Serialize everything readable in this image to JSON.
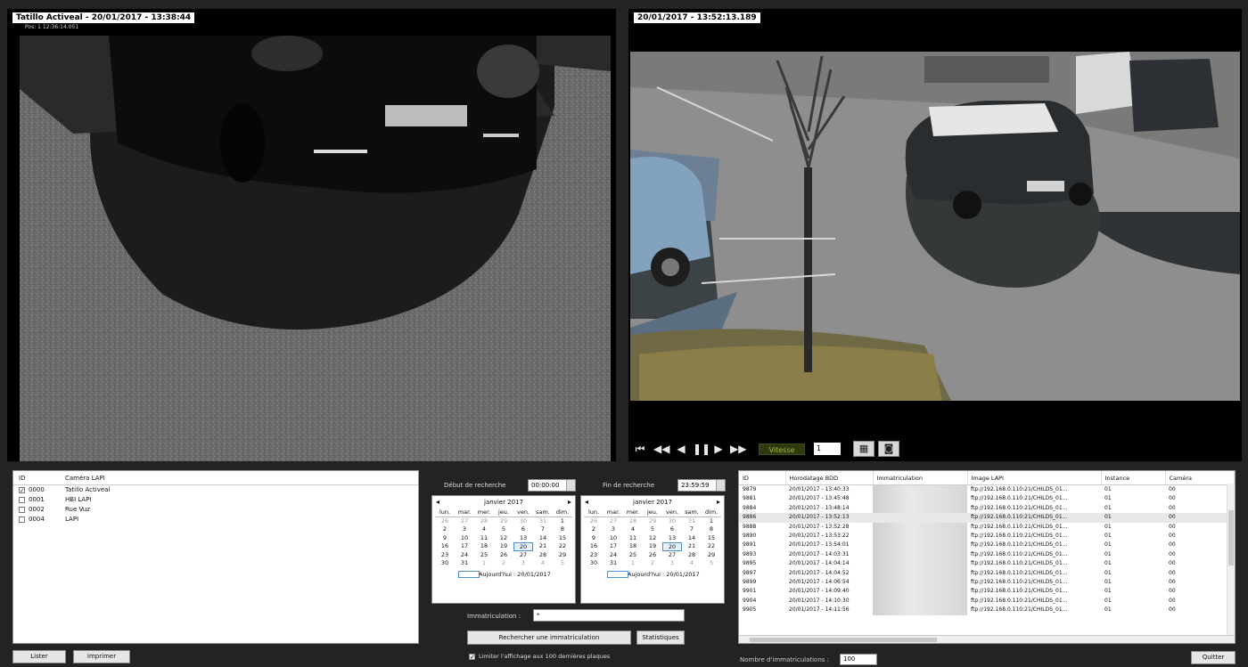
{
  "left_camera": {
    "title": "Tatillo Activeal - 20/01/2017 - 13:38:44",
    "sub": "Pos:          1     12:36:14.051"
  },
  "right_camera": {
    "title": "20/01/2017 - 13:52:13.189"
  },
  "playback": {
    "speed_label": "Vitesse",
    "speed_value": "1"
  },
  "camera_list": {
    "headers": [
      "ID",
      "Caméra LAPI"
    ],
    "rows": [
      {
        "id": "0000",
        "name": "Tatillo Activeal",
        "checked": true
      },
      {
        "id": "0001",
        "name": "HBI LAPI",
        "checked": false
      },
      {
        "id": "0002",
        "name": "Rue Vuz",
        "checked": false
      },
      {
        "id": "0004",
        "name": "LAPI",
        "checked": false
      }
    ],
    "btn_list": "Lister",
    "btn_print": "Imprimer"
  },
  "search": {
    "start_label": "Début de recherche",
    "start_time": "00:00:00",
    "end_label": "Fin de recherche",
    "end_time": "23:59:59",
    "plate_label": "Immatriculation :",
    "plate_value": "*",
    "search_btn": "Rechercher une immatriculation",
    "stats_btn": "Statistiques",
    "limit_label": "Limiter l'affichage aux 100 dernières plaques"
  },
  "calendar": {
    "month": "janvier 2017",
    "days_of_week": [
      "lun.",
      "mar.",
      "mer.",
      "jeu.",
      "ven.",
      "sam.",
      "dim."
    ],
    "weeks": [
      [
        "26",
        "27",
        "28",
        "29",
        "30",
        "31",
        "1"
      ],
      [
        "2",
        "3",
        "4",
        "5",
        "6",
        "7",
        "8"
      ],
      [
        "9",
        "10",
        "11",
        "12",
        "13",
        "14",
        "15"
      ],
      [
        "16",
        "17",
        "18",
        "19",
        "20",
        "21",
        "22"
      ],
      [
        "23",
        "24",
        "25",
        "26",
        "27",
        "28",
        "29"
      ],
      [
        "30",
        "31",
        "1",
        "2",
        "3",
        "4",
        "5"
      ]
    ],
    "selected": "20",
    "today": "Aujourd'hui : 20/01/2017"
  },
  "results": {
    "headers": [
      "ID",
      "Horodatage BDD",
      "Immatriculation",
      "Image LAPI",
      "Instance",
      "Caméra"
    ],
    "rows": [
      [
        "9879",
        "20/01/2017 - 13:40:33",
        "",
        "ftp://192.168.0.110:21/CHILDS_01...",
        "01",
        "00"
      ],
      [
        "9881",
        "20/01/2017 - 13:45:48",
        "",
        "ftp://192.168.0.110:21/CHILDS_01...",
        "01",
        "00"
      ],
      [
        "9884",
        "20/01/2017 - 13:48:14",
        "",
        "ftp://192.168.0.110:21/CHILDS_01...",
        "01",
        "00"
      ],
      [
        "9886",
        "20/01/2017 - 13:52:13",
        "",
        "ftp://192.168.0.110:21/CHILDS_01...",
        "01",
        "00"
      ],
      [
        "9888",
        "20/01/2017 - 13:52:28",
        "",
        "ftp://192.168.0.110:21/CHILDS_01...",
        "01",
        "00"
      ],
      [
        "9890",
        "20/01/2017 - 13:53:22",
        "",
        "ftp://192.168.0.110:21/CHILDS_01...",
        "01",
        "00"
      ],
      [
        "9891",
        "20/01/2017 - 13:54:01",
        "",
        "ftp://192.168.0.110:21/CHILDS_01...",
        "01",
        "00"
      ],
      [
        "9893",
        "20/01/2017 - 14:03:31",
        "",
        "ftp://192.168.0.110:21/CHILDS_01...",
        "01",
        "00"
      ],
      [
        "9895",
        "20/01/2017 - 14:04:14",
        "",
        "ftp://192.168.0.110:21/CHILDS_01...",
        "01",
        "00"
      ],
      [
        "9897",
        "20/01/2017 - 14:04:52",
        "",
        "ftp://192.168.0.110:21/CHILDS_01...",
        "01",
        "00"
      ],
      [
        "9899",
        "20/01/2017 - 14:06:54",
        "",
        "ftp://192.168.0.110:21/CHILDS_01...",
        "01",
        "00"
      ],
      [
        "9901",
        "20/01/2017 - 14:09:40",
        "",
        "ftp://192.168.0.110:21/CHILDS_01...",
        "01",
        "00"
      ],
      [
        "9904",
        "20/01/2017 - 14:10:30",
        "",
        "ftp://192.168.0.110:21/CHILDS_01...",
        "01",
        "00"
      ],
      [
        "9905",
        "20/01/2017 - 14:11:56",
        "",
        "ftp://192.168.0.110:21/CHILDS_01...",
        "01",
        "00"
      ]
    ],
    "highlight_index": 3,
    "count_label": "Nombre d'immatriculations :",
    "count_value": "100",
    "quit_btn": "Quitter"
  }
}
